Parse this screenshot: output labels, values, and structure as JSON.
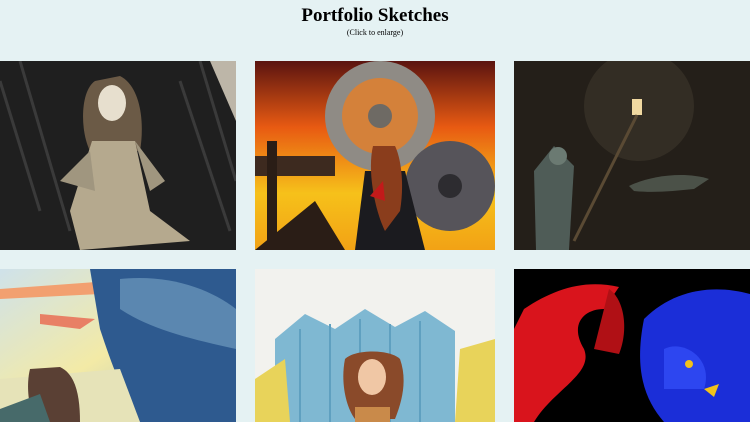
{
  "page": {
    "title": "Portfolio Sketches",
    "subtitle": "(Click to enlarge)"
  },
  "gallery": {
    "items": [
      {
        "subject": "sketch-woman-in-dress"
      },
      {
        "subject": "sketch-girl-with-gears"
      },
      {
        "subject": "sketch-figure-with-lantern-and-dragon"
      },
      {
        "subject": "sketch-girl-by-seaside"
      },
      {
        "subject": "sketch-girl-in-cornfield"
      },
      {
        "subject": "sketch-red-and-blue-dragons"
      }
    ]
  }
}
